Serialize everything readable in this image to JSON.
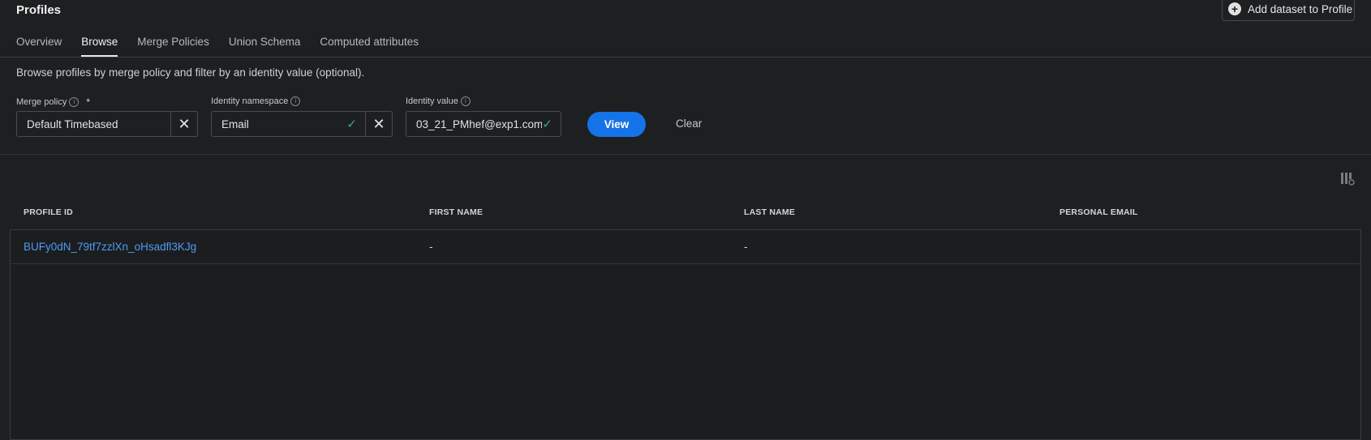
{
  "header": {
    "title": "Profiles",
    "add_dataset_label": "Add dataset to Profile",
    "add_icon": "plus-circle-icon"
  },
  "tabs": [
    {
      "label": "Overview",
      "active": false
    },
    {
      "label": "Browse",
      "active": true
    },
    {
      "label": "Merge Policies",
      "active": false
    },
    {
      "label": "Union Schema",
      "active": false
    },
    {
      "label": "Computed attributes",
      "active": false
    }
  ],
  "description": "Browse profiles by merge policy and filter by an identity value (optional).",
  "filters": {
    "merge_policy": {
      "label": "Merge policy",
      "required_mark": "*",
      "value": "Default Timebased"
    },
    "identity_namespace": {
      "label": "Identity namespace",
      "value": "Email"
    },
    "identity_value": {
      "label": "Identity value",
      "value": "03_21_PMhef@exp1.com"
    }
  },
  "actions": {
    "view_label": "View",
    "clear_label": "Clear"
  },
  "table": {
    "columns": [
      "PROFILE ID",
      "FIRST NAME",
      "LAST NAME",
      "PERSONAL EMAIL"
    ],
    "rows": [
      {
        "profile_id": "BUFy0dN_79tf7zzlXn_oHsadfl3KJg",
        "first_name": "-",
        "last_name": "-",
        "personal_email": ""
      }
    ]
  },
  "colors": {
    "accent": "#1473e6",
    "link": "#4b9cf5",
    "check": "#33ab84",
    "background": "#1e1f21"
  }
}
